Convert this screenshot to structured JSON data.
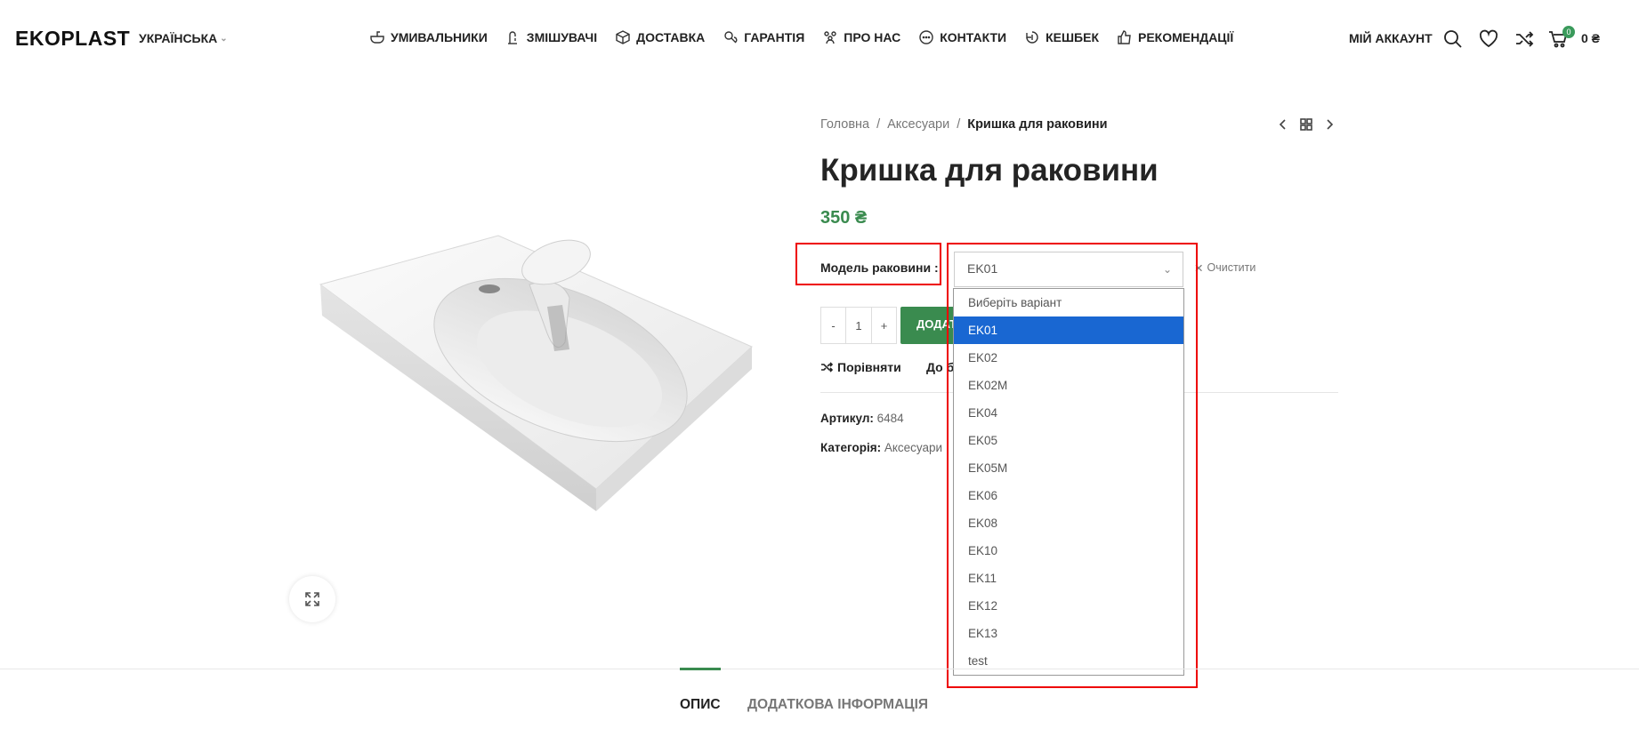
{
  "header": {
    "logo": "EKOPLAST",
    "language": "УКРАЇНСЬКА",
    "nav": [
      {
        "label": "УМИВАЛЬНИКИ",
        "icon": "sink-icon"
      },
      {
        "label": "ЗМІШУВАЧІ",
        "icon": "faucet-icon"
      },
      {
        "label": "ДОСТАВКА",
        "icon": "box-icon"
      },
      {
        "label": "ГАРАНТІЯ",
        "icon": "guarantee-icon"
      },
      {
        "label": "ПРО НАС",
        "icon": "people-icon"
      },
      {
        "label": "КОНТАКТИ",
        "icon": "chat-icon"
      },
      {
        "label": "КЕШБЕК",
        "icon": "cashback-icon"
      },
      {
        "label": "РЕКОМЕНДАЦІЇ",
        "icon": "thumbs-up-icon"
      }
    ],
    "account": "МІЙ АККАУНТ",
    "cart_count": "0",
    "cart_total": "0 ₴"
  },
  "breadcrumb": {
    "home": "Головна",
    "sep": "/",
    "category": "Аксесуари",
    "current": "Кришка для раковини"
  },
  "product": {
    "title": "Кришка для раковини",
    "price": "350 ₴",
    "variation_label": "Модель раковини",
    "variation_colon": ":",
    "selected": "EK01",
    "clear": "Очистити",
    "qty_minus": "-",
    "qty_value": "1",
    "qty_plus": "+",
    "add_to_cart": "ДОДАТИ В КОШИК",
    "compare": "Порівняти",
    "wishlist": "До бажаного",
    "sku_label": "Артикул:",
    "sku": "6484",
    "category_label": "Категорія:",
    "category": "Аксесуари"
  },
  "dropdown": {
    "options": [
      "Виберіть варіант",
      "EK01",
      "EK02",
      "EK02M",
      "EK04",
      "EK05",
      "EK05M",
      "EK06",
      "EK08",
      "EK10",
      "EK11",
      "EK12",
      "EK13",
      "test"
    ],
    "selected_index": 1
  },
  "tabs": {
    "description": "ОПИС",
    "additional": "ДОДАТКОВА ІНФОРМАЦІЯ"
  },
  "colors": {
    "accent": "#3a8b4f",
    "selection": "#1967d2",
    "highlight": "#ee0000"
  }
}
